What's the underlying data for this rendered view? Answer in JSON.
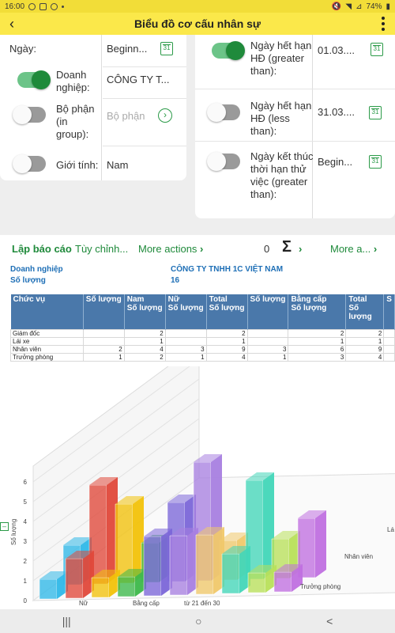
{
  "status": {
    "time": "16:00",
    "battery": "74%"
  },
  "header": {
    "title": "Biểu đồ cơ cấu nhân sự"
  },
  "left_fields": [
    {
      "label": "Ngày:",
      "value": "Beginn...",
      "toggle": null
    },
    {
      "label": "Doanh nghiệp:",
      "value": "CÔNG TY T...",
      "toggle": "on"
    },
    {
      "label": "Bộ phận (in group):",
      "placeholder": "Bộ phận",
      "toggle": "off"
    },
    {
      "label": "Giới tính:",
      "value": "Nam",
      "toggle": "off"
    }
  ],
  "right_fields": [
    {
      "label": "Ngày hết hạn HĐ (greater than):",
      "value": "01.03....",
      "toggle": "on"
    },
    {
      "label": "Ngày hết hạn HĐ (less than):",
      "value": "31.03....",
      "toggle": "off"
    },
    {
      "label": "Ngày kết thúc thời hạn thử việc (greater than):",
      "value": "Begin...",
      "toggle": "off"
    }
  ],
  "toolbar": {
    "tab_report": "Lập báo cáo",
    "tab_custom": "Tùy chỉnh...",
    "more_actions": "More actions",
    "count": "0",
    "more_a": "More a..."
  },
  "report_meta": {
    "label_company": "Doanh nghiệp",
    "company": "CÔNG TY TNHH 1C VIỆT NAM",
    "label_count": "Số lượng",
    "count": "16"
  },
  "table": {
    "headers": [
      [
        "Chức vụ",
        ""
      ],
      [
        "",
        "Số lượng"
      ],
      [
        "Nam",
        "Số lượng"
      ],
      [
        "Nữ",
        "Số lượng"
      ],
      [
        "Total",
        "Số lượng"
      ],
      [
        "",
        "Số lượng"
      ],
      [
        "Bằng cấp",
        "Số lượng"
      ],
      [
        "Total",
        "Số lượng"
      ],
      [
        "S",
        ""
      ]
    ],
    "rows": [
      [
        "Giám đốc",
        "",
        "2",
        "",
        "2",
        "",
        "2",
        "2",
        ""
      ],
      [
        "Lái xe",
        "",
        "1",
        "",
        "1",
        "",
        "1",
        "1",
        ""
      ],
      [
        "Nhân viên",
        "2",
        "4",
        "3",
        "9",
        "3",
        "6",
        "9",
        ""
      ],
      [
        "Trưởng phòng",
        "1",
        "2",
        "1",
        "4",
        "1",
        "3",
        "4",
        ""
      ]
    ]
  },
  "chart_data": {
    "type": "bar",
    "ylabel": "Số lượng",
    "yticks": [
      "0",
      "1",
      "2",
      "3",
      "4",
      "5",
      "6"
    ],
    "ylim": [
      0,
      6
    ],
    "x_labels": [
      "Nữ",
      "Bằng cấp",
      "từ 21 đến 30"
    ],
    "depth_labels": [
      "Trưởng phòng",
      "Nhân viên",
      "Lá"
    ],
    "colors": [
      "#2fb8e8",
      "#e0483a",
      "#f2c20a",
      "#3cb84a",
      "#7b66d8",
      "#a880e0",
      "#f0c86a",
      "#42d6b8",
      "#b8e05a",
      "#c070e0"
    ],
    "series": [
      {
        "name": "Trưởng phòng",
        "values": [
          1,
          2,
          1,
          1,
          3,
          3,
          3,
          2,
          1,
          1
        ]
      },
      {
        "name": "Nhân viên",
        "values": [
          2,
          5,
          4,
          2,
          4,
          6,
          2,
          5,
          2,
          3
        ]
      }
    ]
  },
  "nav": {
    "recent": "|||",
    "home": "○",
    "back": "<"
  }
}
